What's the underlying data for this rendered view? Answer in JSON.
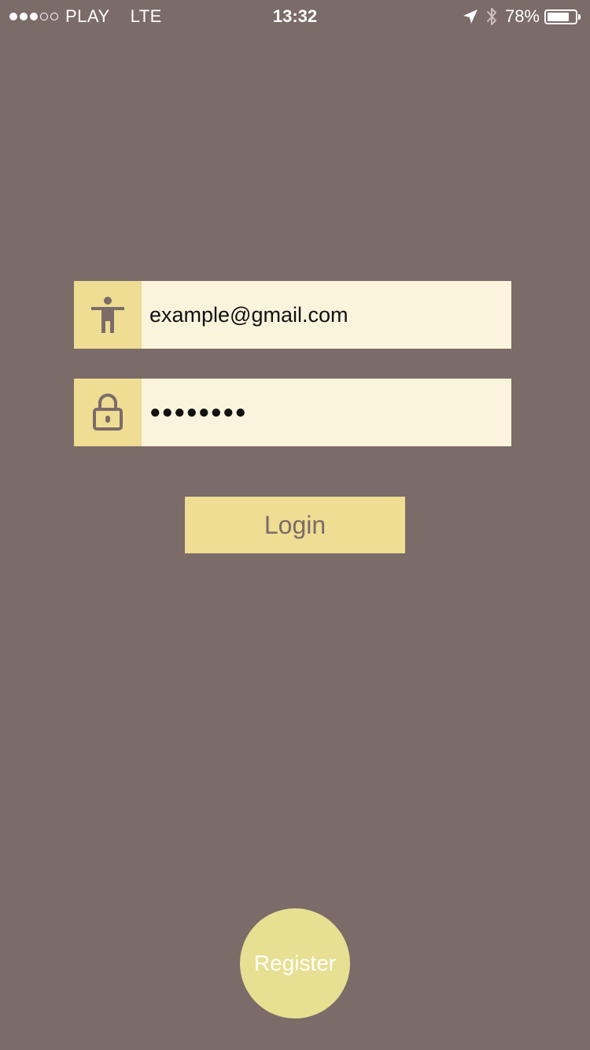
{
  "status_bar": {
    "signal_strength": 3,
    "signal_max": 5,
    "carrier": "PLAY",
    "network": "LTE",
    "time": "13:32",
    "battery_percent": "78%",
    "battery_level": 0.78,
    "icons": [
      "location-arrow-icon",
      "bluetooth-icon",
      "battery-icon"
    ]
  },
  "login_form": {
    "email": {
      "icon": "person-icon",
      "value": "example@gmail.com"
    },
    "password": {
      "icon": "lock-icon",
      "masked_value": "●●●●●●●●"
    },
    "login_label": "Login"
  },
  "register_label": "Register",
  "colors": {
    "background": "#7b6b69",
    "accent": "#eedd92",
    "field_background": "#fbf4dc",
    "register_button": "#e7df91"
  }
}
